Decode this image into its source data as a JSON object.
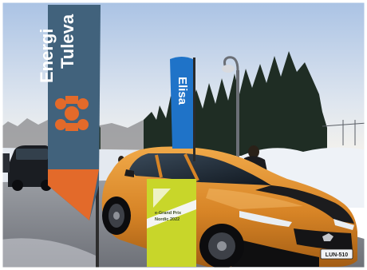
{
  "photo": {
    "subject": "",
    "colors": {
      "sky_top": "#b9cde8",
      "sky_bottom": "#f4f1ea",
      "snow": "#f2f5f8",
      "forest": "#1f2d24",
      "road": "#7c7f86",
      "car_body": "#d98a2a",
      "car_stripe": "#1c1c1e",
      "flag_blue": "#41627c",
      "flag_orange": "#e36a2a",
      "flag_right": "#1f73c8",
      "sign_yellow": "#c8d62a"
    }
  },
  "flags": {
    "left_banner": {
      "line1": "Energi",
      "line2": "Tuleva"
    },
    "right_banner": {
      "text": "Elisa"
    }
  },
  "sign": {
    "title": "e-Grand Prix",
    "subtitle": "Nordic 2022"
  },
  "car": {
    "plate": "LUN-510"
  }
}
